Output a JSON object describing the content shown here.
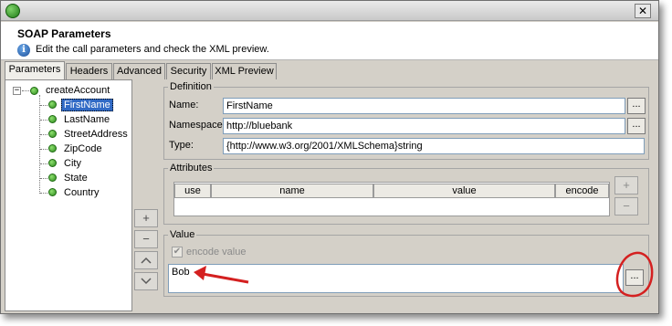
{
  "window": {
    "close_label": "✕"
  },
  "header": {
    "title": "SOAP Parameters",
    "description": "Edit the call parameters and check the XML preview."
  },
  "tabs": [
    {
      "label": "Parameters",
      "active": true
    },
    {
      "label": "Headers"
    },
    {
      "label": "Advanced"
    },
    {
      "label": "Security"
    },
    {
      "label": "XML Preview"
    }
  ],
  "tree": {
    "root": "createAccount",
    "expander": "−",
    "children": [
      "FirstName",
      "LastName",
      "StreetAddress",
      "ZipCode",
      "City",
      "State",
      "Country"
    ],
    "selected": "FirstName"
  },
  "side_buttons": {
    "add": "+",
    "remove": "−",
    "up": "⌃",
    "down": "⌄"
  },
  "definition": {
    "legend": "Definition",
    "name_label": "Name:",
    "name_value": "FirstName",
    "namespace_label": "Namespace:",
    "namespace_value": "http://bluebank",
    "type_label": "Type:",
    "type_value": "{http://www.w3.org/2001/XMLSchema}string",
    "ellipsis": "..."
  },
  "attributes": {
    "legend": "Attributes",
    "columns": [
      "use",
      "name",
      "value",
      "encode"
    ],
    "add": "+",
    "remove": "−"
  },
  "value_group": {
    "legend": "Value",
    "encode_label": "encode value",
    "encode_checked": true,
    "check_mark": "✔",
    "value_text": "Bob",
    "ellipsis": "..."
  },
  "colors": {
    "selection": "#316ac5",
    "annotation_red": "#d42020",
    "tree_dot": "#2e8a1e"
  }
}
